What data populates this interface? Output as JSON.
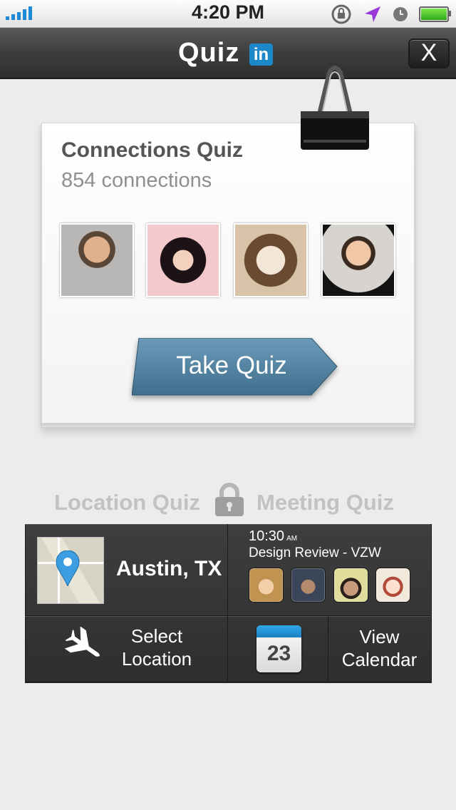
{
  "status_bar": {
    "time": "4:20 PM"
  },
  "header": {
    "title": "Quiz",
    "brand_badge": "in",
    "close_label": "X"
  },
  "connections_card": {
    "title": "Connections Quiz",
    "subtitle": "854 connections",
    "button_label": "Take Quiz"
  },
  "quiz_tabs": {
    "location": "Location Quiz",
    "meeting": "Meeting Quiz"
  },
  "location": {
    "city": "Austin, TX",
    "select_label_line1": "Select",
    "select_label_line2": "Location"
  },
  "meeting": {
    "time": "10:30",
    "ampm": "AM",
    "event": "Design Review - VZW",
    "calendar_day": "23",
    "view_label_line1": "View",
    "view_label_line2": "Calendar"
  },
  "colors": {
    "accent_blue": "#4e7f9c",
    "linkedin_blue": "#1c87c9",
    "calendar_blue": "#2fa8e8"
  }
}
